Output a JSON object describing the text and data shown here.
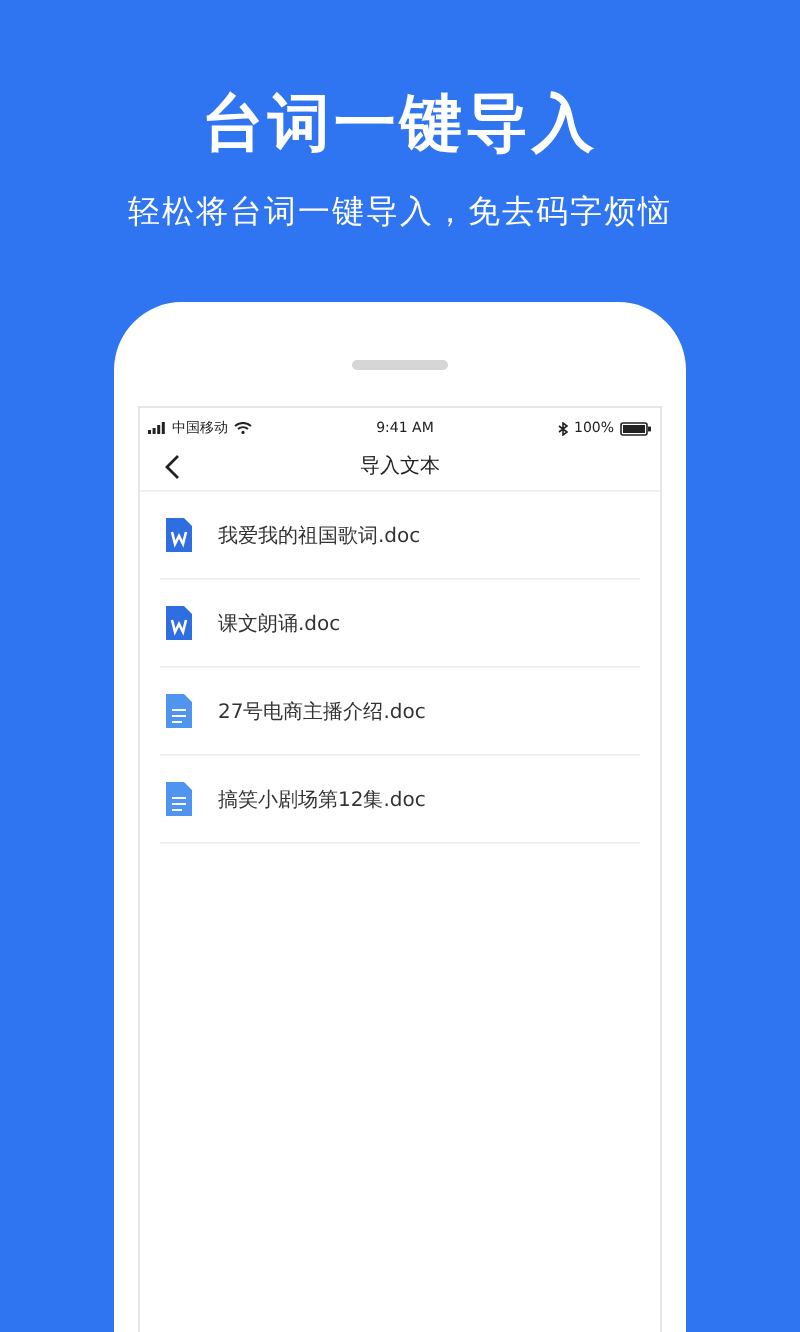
{
  "headline": "台词一键导入",
  "subtitle": "轻松将台词一键导入，免去码字烦恼",
  "status_bar": {
    "carrier": "中国移动",
    "time": "9:41 AM",
    "battery": "100%"
  },
  "nav": {
    "title": "导入文本"
  },
  "files": [
    {
      "name": "我爱我的祖国歌词.doc",
      "kind": "word"
    },
    {
      "name": "课文朗诵.doc",
      "kind": "word"
    },
    {
      "name": "27号电商主播介绍.doc",
      "kind": "text"
    },
    {
      "name": "搞笑小剧场第12集.doc",
      "kind": "text"
    }
  ]
}
